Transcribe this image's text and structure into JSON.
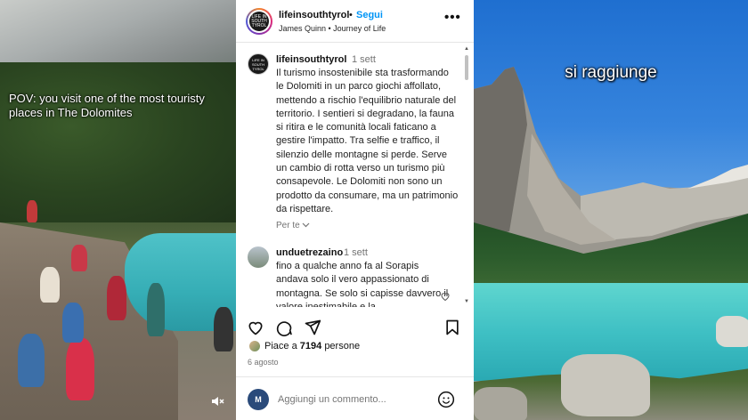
{
  "left_video": {
    "caption": "POV: you visit one of the most touristy places in The  Dolomites"
  },
  "post": {
    "header": {
      "username": "lifeinsouthtyrol",
      "separator": "•",
      "follow_label": "Segui",
      "subtitle": "James Quinn • Journey of Life",
      "avatar_text": "LIFE IN SOUTH TYROL"
    },
    "caption": {
      "username": "lifeinsouthtyrol",
      "time": "1 sett",
      "text": "Il turismo insostenibile sta trasformando le Dolomiti in un parco giochi affollato, mettendo a rischio l'equilibrio naturale del territorio. I sentieri si degradano, la fauna si ritira e le comunità locali faticano a gestire l'impatto. Tra selfie e traffico, il silenzio delle montagne si perde. Serve un cambio di rotta verso un turismo più consapevole. Le Dolomiti non sono un prodotto da consumare, ma un patrimonio da rispettare.",
      "see_translation": "Per te"
    },
    "comments": [
      {
        "username": "unduetrezaino",
        "time": "1 sett",
        "text": "fino a qualche anno fa al Sorapis andava solo il vero appassionato di montagna. Se solo si capisse davvero il valore inestimabile e la"
      }
    ],
    "likes": {
      "prefix": "Piace a",
      "count": "7194",
      "suffix": "persone"
    },
    "date": "6 agosto",
    "comment_input": {
      "placeholder": "Aggiungi un commento...",
      "avatar_letter": "M"
    }
  },
  "right_video": {
    "caption": "si raggiunge"
  },
  "colors": {
    "follow_blue": "#0095f6",
    "secondary_text": "#737373"
  }
}
